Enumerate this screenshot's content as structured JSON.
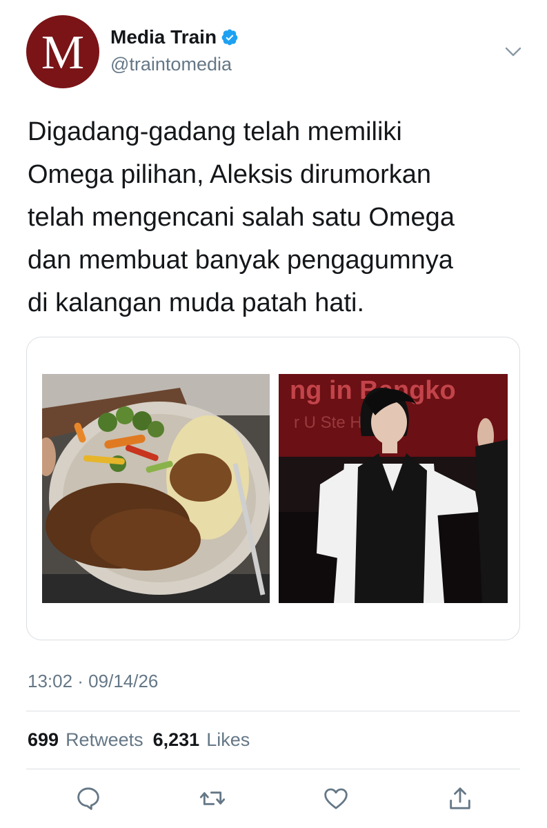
{
  "author": {
    "avatar_letter": "M",
    "avatar_color": "#7a1417",
    "display_name": "Media Train",
    "handle": "@traintomedia",
    "verified": true,
    "verified_icon": "verified-badge-icon"
  },
  "tweet": {
    "text": "Digadang-gadang telah memiliki\nOmega pilihan, Aleksis dirumorkan\ntelah mengencani salah satu Omega\ndan membuat banyak pengagumnya\ndi kalangan muda patah hati.",
    "timestamp": "13:02 · 09/14/26",
    "media": [
      {
        "kind": "photo",
        "subject": "plate-of-steak-with-vegetables-and-mashed-potatoes"
      },
      {
        "kind": "photo",
        "subject": "young-man-in-white-shirt-and-black-vest-on-stage",
        "backdrop_text": "ng in Bangko",
        "backdrop_subtext": "r U Ste      Heart"
      }
    ]
  },
  "stats": {
    "retweets_count": "699",
    "retweets_label": "Retweets",
    "likes_count": "6,231",
    "likes_label": "Likes"
  },
  "actions": [
    {
      "name": "reply",
      "icon": "reply-icon"
    },
    {
      "name": "retweet",
      "icon": "retweet-icon"
    },
    {
      "name": "like",
      "icon": "heart-icon"
    },
    {
      "name": "share",
      "icon": "share-icon"
    }
  ],
  "colors": {
    "text_primary": "#14171a",
    "text_secondary": "#657786",
    "verified_blue": "#1da1f2",
    "divider": "#d9dee2"
  }
}
